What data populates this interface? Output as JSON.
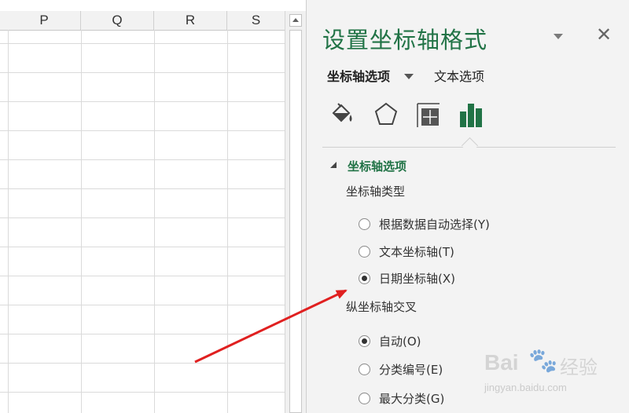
{
  "sheet": {
    "columns": [
      "P",
      "Q",
      "R",
      "S"
    ]
  },
  "pane": {
    "title": "设置坐标轴格式",
    "tabs": {
      "axis_options": "坐标轴选项",
      "text_options": "文本选项"
    },
    "icons": [
      "fill-line-icon",
      "effects-pentagon-icon",
      "size-properties-icon",
      "axis-options-bar-chart-icon"
    ],
    "section": {
      "title": "坐标轴选项",
      "axis_type_label": "坐标轴类型",
      "axis_type_options": [
        {
          "label": "根据数据自动选择(Y)",
          "checked": false
        },
        {
          "label": "文本坐标轴(T)",
          "checked": false
        },
        {
          "label": "日期坐标轴(X)",
          "checked": true
        }
      ],
      "crosses_label": "纵坐标轴交叉",
      "crosses_options": [
        {
          "label": "自动(O)",
          "checked": true
        },
        {
          "label": "分类编号(E)",
          "checked": false
        },
        {
          "label": "最大分类(G)",
          "checked": false
        }
      ]
    },
    "close_glyph": "✕"
  },
  "watermark": {
    "brand": "Bai",
    "paw": "🐾",
    "jingyan": "经验",
    "url": "jingyan.baidu.com"
  },
  "colors": {
    "accent_green": "#217346",
    "annotation_red": "#e02020"
  }
}
